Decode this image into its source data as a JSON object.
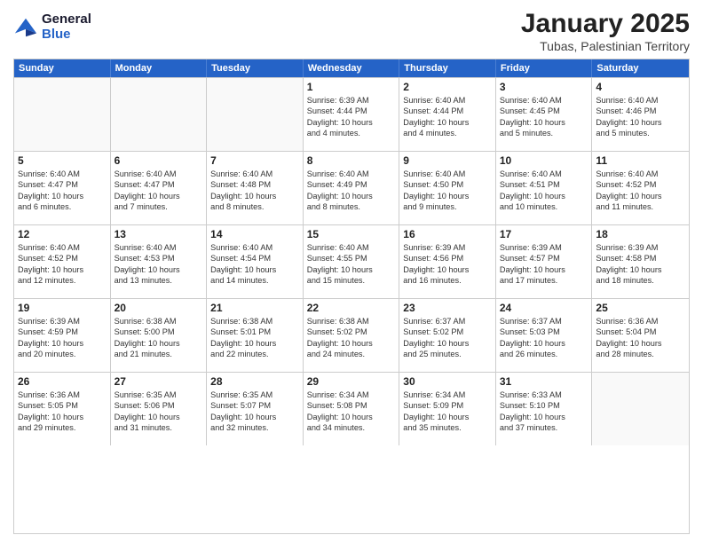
{
  "header": {
    "logo_line1": "General",
    "logo_line2": "Blue",
    "title": "January 2025",
    "subtitle": "Tubas, Palestinian Territory"
  },
  "days_of_week": [
    "Sunday",
    "Monday",
    "Tuesday",
    "Wednesday",
    "Thursday",
    "Friday",
    "Saturday"
  ],
  "weeks": [
    [
      {
        "num": "",
        "info": ""
      },
      {
        "num": "",
        "info": ""
      },
      {
        "num": "",
        "info": ""
      },
      {
        "num": "1",
        "info": "Sunrise: 6:39 AM\nSunset: 4:44 PM\nDaylight: 10 hours\nand 4 minutes."
      },
      {
        "num": "2",
        "info": "Sunrise: 6:40 AM\nSunset: 4:44 PM\nDaylight: 10 hours\nand 4 minutes."
      },
      {
        "num": "3",
        "info": "Sunrise: 6:40 AM\nSunset: 4:45 PM\nDaylight: 10 hours\nand 5 minutes."
      },
      {
        "num": "4",
        "info": "Sunrise: 6:40 AM\nSunset: 4:46 PM\nDaylight: 10 hours\nand 5 minutes."
      }
    ],
    [
      {
        "num": "5",
        "info": "Sunrise: 6:40 AM\nSunset: 4:47 PM\nDaylight: 10 hours\nand 6 minutes."
      },
      {
        "num": "6",
        "info": "Sunrise: 6:40 AM\nSunset: 4:47 PM\nDaylight: 10 hours\nand 7 minutes."
      },
      {
        "num": "7",
        "info": "Sunrise: 6:40 AM\nSunset: 4:48 PM\nDaylight: 10 hours\nand 8 minutes."
      },
      {
        "num": "8",
        "info": "Sunrise: 6:40 AM\nSunset: 4:49 PM\nDaylight: 10 hours\nand 8 minutes."
      },
      {
        "num": "9",
        "info": "Sunrise: 6:40 AM\nSunset: 4:50 PM\nDaylight: 10 hours\nand 9 minutes."
      },
      {
        "num": "10",
        "info": "Sunrise: 6:40 AM\nSunset: 4:51 PM\nDaylight: 10 hours\nand 10 minutes."
      },
      {
        "num": "11",
        "info": "Sunrise: 6:40 AM\nSunset: 4:52 PM\nDaylight: 10 hours\nand 11 minutes."
      }
    ],
    [
      {
        "num": "12",
        "info": "Sunrise: 6:40 AM\nSunset: 4:52 PM\nDaylight: 10 hours\nand 12 minutes."
      },
      {
        "num": "13",
        "info": "Sunrise: 6:40 AM\nSunset: 4:53 PM\nDaylight: 10 hours\nand 13 minutes."
      },
      {
        "num": "14",
        "info": "Sunrise: 6:40 AM\nSunset: 4:54 PM\nDaylight: 10 hours\nand 14 minutes."
      },
      {
        "num": "15",
        "info": "Sunrise: 6:40 AM\nSunset: 4:55 PM\nDaylight: 10 hours\nand 15 minutes."
      },
      {
        "num": "16",
        "info": "Sunrise: 6:39 AM\nSunset: 4:56 PM\nDaylight: 10 hours\nand 16 minutes."
      },
      {
        "num": "17",
        "info": "Sunrise: 6:39 AM\nSunset: 4:57 PM\nDaylight: 10 hours\nand 17 minutes."
      },
      {
        "num": "18",
        "info": "Sunrise: 6:39 AM\nSunset: 4:58 PM\nDaylight: 10 hours\nand 18 minutes."
      }
    ],
    [
      {
        "num": "19",
        "info": "Sunrise: 6:39 AM\nSunset: 4:59 PM\nDaylight: 10 hours\nand 20 minutes."
      },
      {
        "num": "20",
        "info": "Sunrise: 6:38 AM\nSunset: 5:00 PM\nDaylight: 10 hours\nand 21 minutes."
      },
      {
        "num": "21",
        "info": "Sunrise: 6:38 AM\nSunset: 5:01 PM\nDaylight: 10 hours\nand 22 minutes."
      },
      {
        "num": "22",
        "info": "Sunrise: 6:38 AM\nSunset: 5:02 PM\nDaylight: 10 hours\nand 24 minutes."
      },
      {
        "num": "23",
        "info": "Sunrise: 6:37 AM\nSunset: 5:02 PM\nDaylight: 10 hours\nand 25 minutes."
      },
      {
        "num": "24",
        "info": "Sunrise: 6:37 AM\nSunset: 5:03 PM\nDaylight: 10 hours\nand 26 minutes."
      },
      {
        "num": "25",
        "info": "Sunrise: 6:36 AM\nSunset: 5:04 PM\nDaylight: 10 hours\nand 28 minutes."
      }
    ],
    [
      {
        "num": "26",
        "info": "Sunrise: 6:36 AM\nSunset: 5:05 PM\nDaylight: 10 hours\nand 29 minutes."
      },
      {
        "num": "27",
        "info": "Sunrise: 6:35 AM\nSunset: 5:06 PM\nDaylight: 10 hours\nand 31 minutes."
      },
      {
        "num": "28",
        "info": "Sunrise: 6:35 AM\nSunset: 5:07 PM\nDaylight: 10 hours\nand 32 minutes."
      },
      {
        "num": "29",
        "info": "Sunrise: 6:34 AM\nSunset: 5:08 PM\nDaylight: 10 hours\nand 34 minutes."
      },
      {
        "num": "30",
        "info": "Sunrise: 6:34 AM\nSunset: 5:09 PM\nDaylight: 10 hours\nand 35 minutes."
      },
      {
        "num": "31",
        "info": "Sunrise: 6:33 AM\nSunset: 5:10 PM\nDaylight: 10 hours\nand 37 minutes."
      },
      {
        "num": "",
        "info": ""
      }
    ]
  ]
}
